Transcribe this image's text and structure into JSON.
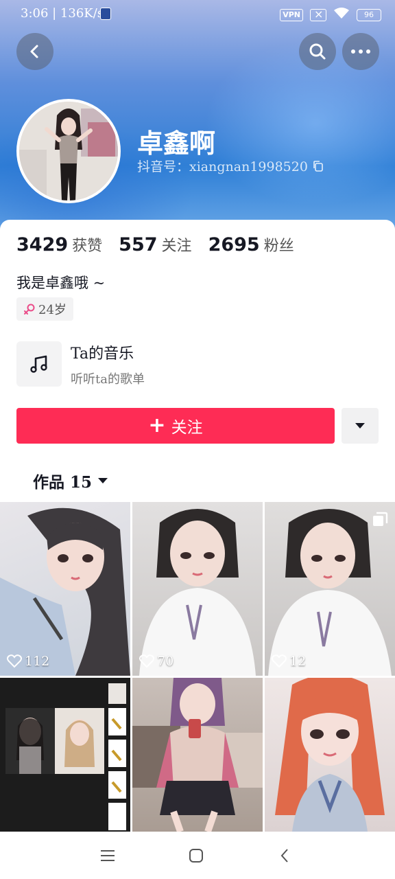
{
  "status_bar": {
    "time_speed": "3:06 | 136K/s",
    "vpn": "VPN",
    "battery": "96"
  },
  "profile": {
    "nickname": "卓鑫啊",
    "douyin_id": "抖音号：xiangnan1998520"
  },
  "stats": [
    {
      "value": "3429",
      "label": "获赞"
    },
    {
      "value": "557",
      "label": "关注"
    },
    {
      "value": "2695",
      "label": "粉丝"
    }
  ],
  "bio": "我是卓鑫哦 ~",
  "age_tag": "24岁",
  "music": {
    "title": "Ta的音乐",
    "subtitle": "听听ta的歌单"
  },
  "actions": {
    "follow_label": "关注"
  },
  "works_tab": {
    "label": "作品 15"
  },
  "videos": [
    {
      "likes": "112"
    },
    {
      "likes": "70"
    },
    {
      "likes": "12"
    },
    {
      "likes": ""
    },
    {
      "likes": ""
    },
    {
      "likes": ""
    }
  ],
  "icons": {
    "back": "back-arrow-icon",
    "search": "search-icon",
    "more": "more-dots-icon",
    "copy": "copy-icon",
    "gender": "female-icon",
    "music": "music-note-icon",
    "dropdown": "caret-down-icon",
    "heart": "heart-outline-icon",
    "multi": "multi-image-icon"
  },
  "colors": {
    "accent": "#fe2c55",
    "header_blue": "#2f7fd6"
  }
}
